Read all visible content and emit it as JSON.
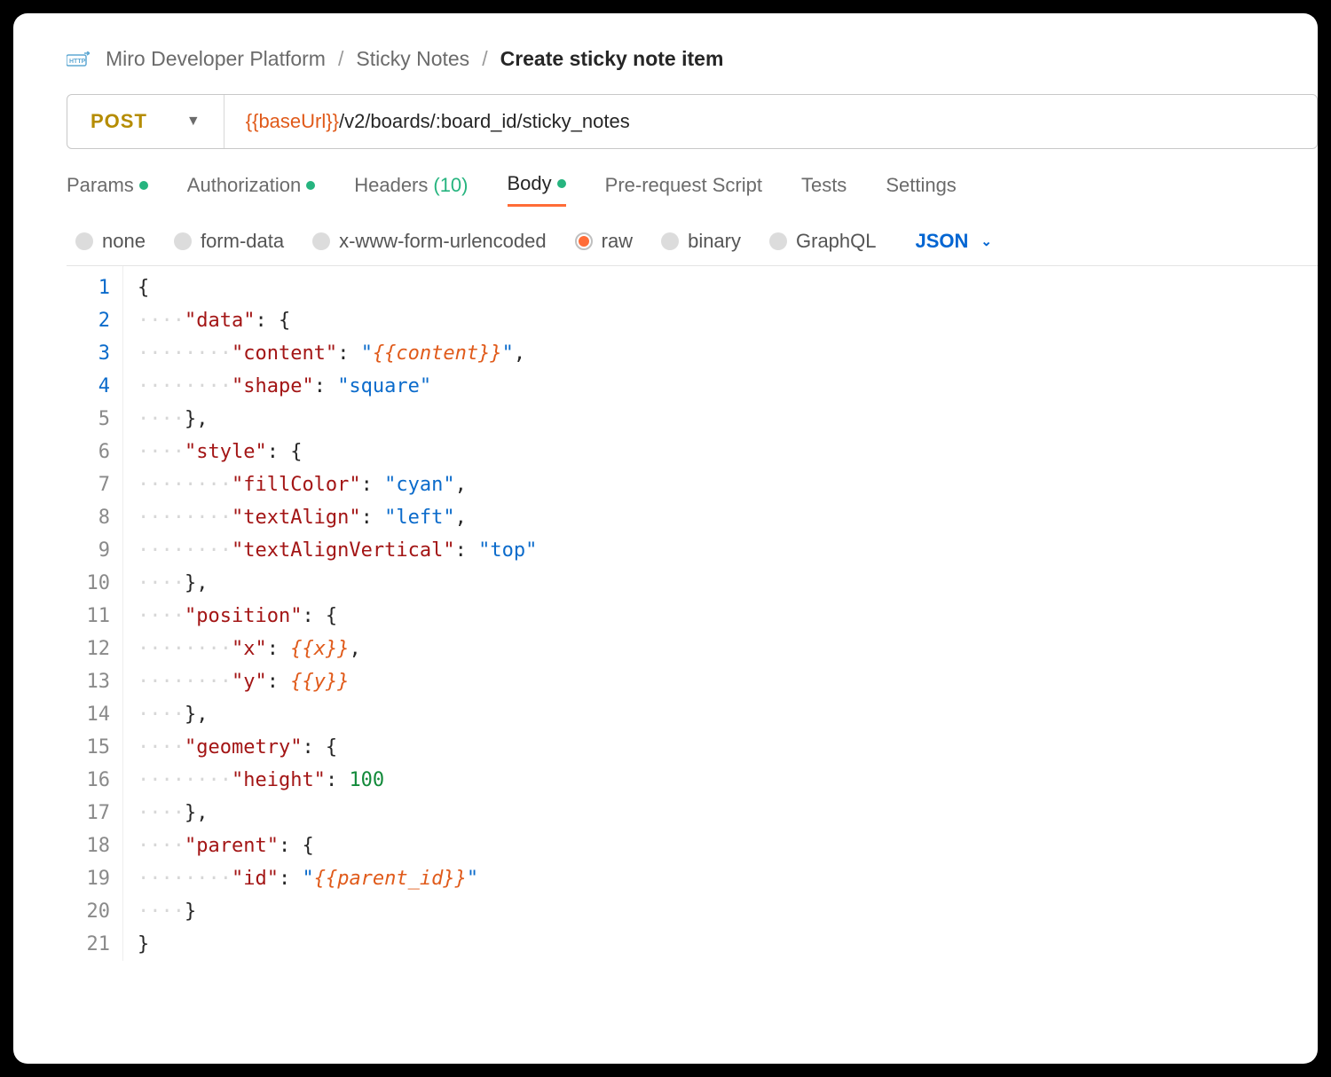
{
  "breadcrumb": {
    "segments": [
      "Miro Developer Platform",
      "Sticky Notes"
    ],
    "current": "Create sticky note item",
    "separator": "/"
  },
  "request": {
    "method": "POST",
    "url_var": "{{baseUrl}}",
    "url_path": "/v2/boards/:board_id/sticky_notes"
  },
  "tabs": {
    "params": "Params",
    "auth": "Authorization",
    "headers": "Headers",
    "headers_count": "(10)",
    "body": "Body",
    "prerequest": "Pre-request Script",
    "tests": "Tests",
    "settings": "Settings"
  },
  "body_types": {
    "none": "none",
    "formdata": "form-data",
    "urlencoded": "x-www-form-urlencoded",
    "raw": "raw",
    "binary": "binary",
    "graphql": "GraphQL",
    "format_label": "JSON"
  },
  "code": {
    "line_count": 21,
    "tokens": [
      [
        {
          "t": "pun",
          "v": "{"
        }
      ],
      [
        {
          "t": "ws",
          "v": "····"
        },
        {
          "t": "key",
          "v": "\"data\""
        },
        {
          "t": "pun",
          "v": ":·{"
        }
      ],
      [
        {
          "t": "ws",
          "v": "········"
        },
        {
          "t": "key",
          "v": "\"content\""
        },
        {
          "t": "pun",
          "v": ":·"
        },
        {
          "t": "str",
          "v": "\""
        },
        {
          "t": "var",
          "v": "{{content}}"
        },
        {
          "t": "str",
          "v": "\""
        },
        {
          "t": "pun",
          "v": ","
        }
      ],
      [
        {
          "t": "ws",
          "v": "········"
        },
        {
          "t": "key",
          "v": "\"shape\""
        },
        {
          "t": "pun",
          "v": ":·"
        },
        {
          "t": "str",
          "v": "\"square\""
        }
      ],
      [
        {
          "t": "ws",
          "v": "····"
        },
        {
          "t": "pun",
          "v": "},"
        }
      ],
      [
        {
          "t": "ws",
          "v": "····"
        },
        {
          "t": "key",
          "v": "\"style\""
        },
        {
          "t": "pun",
          "v": ":·{"
        }
      ],
      [
        {
          "t": "ws",
          "v": "········"
        },
        {
          "t": "key",
          "v": "\"fillColor\""
        },
        {
          "t": "pun",
          "v": ":·"
        },
        {
          "t": "str",
          "v": "\"cyan\""
        },
        {
          "t": "pun",
          "v": ","
        }
      ],
      [
        {
          "t": "ws",
          "v": "········"
        },
        {
          "t": "key",
          "v": "\"textAlign\""
        },
        {
          "t": "pun",
          "v": ":·"
        },
        {
          "t": "str",
          "v": "\"left\""
        },
        {
          "t": "pun",
          "v": ","
        }
      ],
      [
        {
          "t": "ws",
          "v": "········"
        },
        {
          "t": "key",
          "v": "\"textAlignVertical\""
        },
        {
          "t": "pun",
          "v": ":·"
        },
        {
          "t": "str",
          "v": "\"top\""
        }
      ],
      [
        {
          "t": "ws",
          "v": "····"
        },
        {
          "t": "pun",
          "v": "},"
        }
      ],
      [
        {
          "t": "ws",
          "v": "····"
        },
        {
          "t": "key",
          "v": "\"position\""
        },
        {
          "t": "pun",
          "v": ":·{"
        }
      ],
      [
        {
          "t": "ws",
          "v": "········"
        },
        {
          "t": "key",
          "v": "\"x\""
        },
        {
          "t": "pun",
          "v": ":·"
        },
        {
          "t": "var",
          "v": "{{x}}"
        },
        {
          "t": "pun",
          "v": ","
        }
      ],
      [
        {
          "t": "ws",
          "v": "········"
        },
        {
          "t": "key",
          "v": "\"y\""
        },
        {
          "t": "pun",
          "v": ":·"
        },
        {
          "t": "var",
          "v": "{{y}}"
        }
      ],
      [
        {
          "t": "ws",
          "v": "····"
        },
        {
          "t": "pun",
          "v": "},"
        }
      ],
      [
        {
          "t": "ws",
          "v": "····"
        },
        {
          "t": "key",
          "v": "\"geometry\""
        },
        {
          "t": "pun",
          "v": ":·{"
        }
      ],
      [
        {
          "t": "ws",
          "v": "········"
        },
        {
          "t": "key",
          "v": "\"height\""
        },
        {
          "t": "pun",
          "v": ":·"
        },
        {
          "t": "num",
          "v": "100"
        }
      ],
      [
        {
          "t": "ws",
          "v": "····"
        },
        {
          "t": "pun",
          "v": "},"
        }
      ],
      [
        {
          "t": "ws",
          "v": "····"
        },
        {
          "t": "key",
          "v": "\"parent\""
        },
        {
          "t": "pun",
          "v": ":·{"
        }
      ],
      [
        {
          "t": "ws",
          "v": "········"
        },
        {
          "t": "key",
          "v": "\"id\""
        },
        {
          "t": "pun",
          "v": ":·"
        },
        {
          "t": "str",
          "v": "\""
        },
        {
          "t": "var",
          "v": "{{parent_id}}"
        },
        {
          "t": "str",
          "v": "\""
        }
      ],
      [
        {
          "t": "ws",
          "v": "····"
        },
        {
          "t": "pun",
          "v": "}"
        }
      ],
      [
        {
          "t": "pun",
          "v": "}"
        }
      ]
    ]
  }
}
